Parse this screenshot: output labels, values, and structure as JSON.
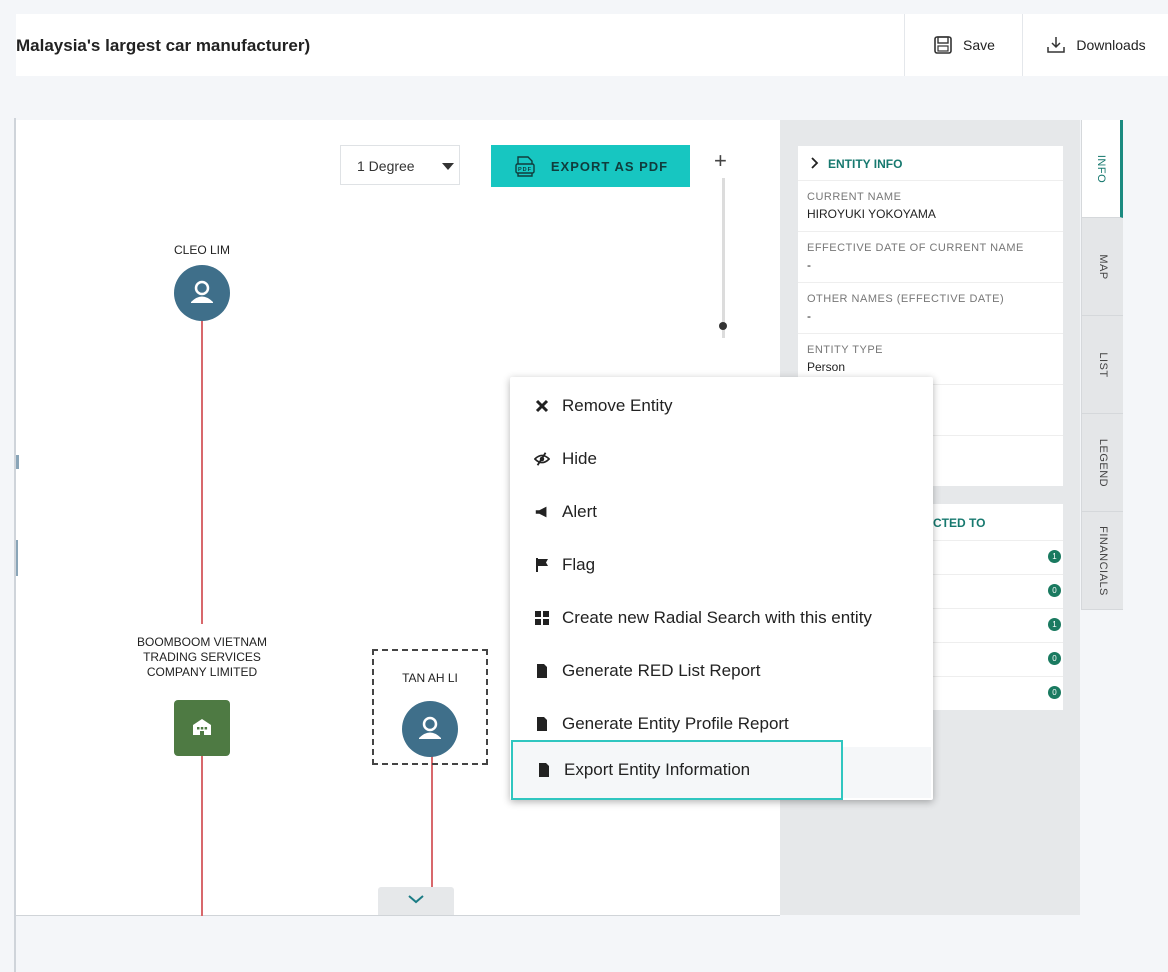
{
  "header": {
    "title": "Malaysia's largest car manufacturer)",
    "save_label": "Save",
    "downloads_label": "Downloads"
  },
  "toolbar": {
    "degree_value": "1 Degree",
    "export_pdf_label": "EXPORT AS PDF",
    "pdf_icon_text": "PDF",
    "zoom_in": "+"
  },
  "graph": {
    "nodes": [
      {
        "label": "CLEO LIM",
        "type": "person"
      },
      {
        "label": "BOOMBOOM VIETNAM TRADING SERVICES COMPANY LIMITED",
        "label_lines": [
          "BOOMBOOM VIETNAM",
          "TRADING SERVICES",
          "COMPANY LIMITED"
        ],
        "type": "organization"
      },
      {
        "label": "TAN AH LI",
        "type": "person",
        "selected": true
      }
    ]
  },
  "entity_info": {
    "header": "ENTITY INFO",
    "fields": [
      {
        "label": "CURRENT NAME",
        "value": "HIROYUKI YOKOYAMA"
      },
      {
        "label": "EFFECTIVE DATE OF CURRENT NAME",
        "value": "-"
      },
      {
        "label": "OTHER NAMES (EFFECTIVE DATE)",
        "value": "-"
      },
      {
        "label": "ENTITY TYPE",
        "value": "Person"
      }
    ]
  },
  "connected_to": {
    "header_visible": "CTED TO",
    "counts": [
      "1",
      "0",
      "1",
      "0",
      "0"
    ]
  },
  "side_tabs": [
    {
      "label": "INFO",
      "active": true
    },
    {
      "label": "MAP",
      "active": false
    },
    {
      "label": "LIST",
      "active": false
    },
    {
      "label": "LEGEND",
      "active": false
    },
    {
      "label": "FINANCIALS",
      "active": false
    }
  ],
  "context_menu": {
    "items": [
      {
        "label": "Remove Entity",
        "icon": "close-x-icon"
      },
      {
        "label": "Hide",
        "icon": "eye-slash-icon"
      },
      {
        "label": "Alert",
        "icon": "megaphone-icon"
      },
      {
        "label": "Flag",
        "icon": "flag-icon"
      },
      {
        "label": "Create new Radial Search with this entity",
        "icon": "grid-icon"
      },
      {
        "label": "Generate RED List Report",
        "icon": "document-icon"
      },
      {
        "label": "Generate Entity Profile Report",
        "icon": "document-icon"
      },
      {
        "label": "Export Entity Information",
        "icon": "document-icon",
        "highlighted": true
      }
    ]
  },
  "colors": {
    "accent_teal": "#17c6c1",
    "teal_text": "#17796f",
    "person_node": "#3f6f8a",
    "org_node": "#4e7a43",
    "edge": "#d8686c",
    "badge": "#1a7a60"
  }
}
